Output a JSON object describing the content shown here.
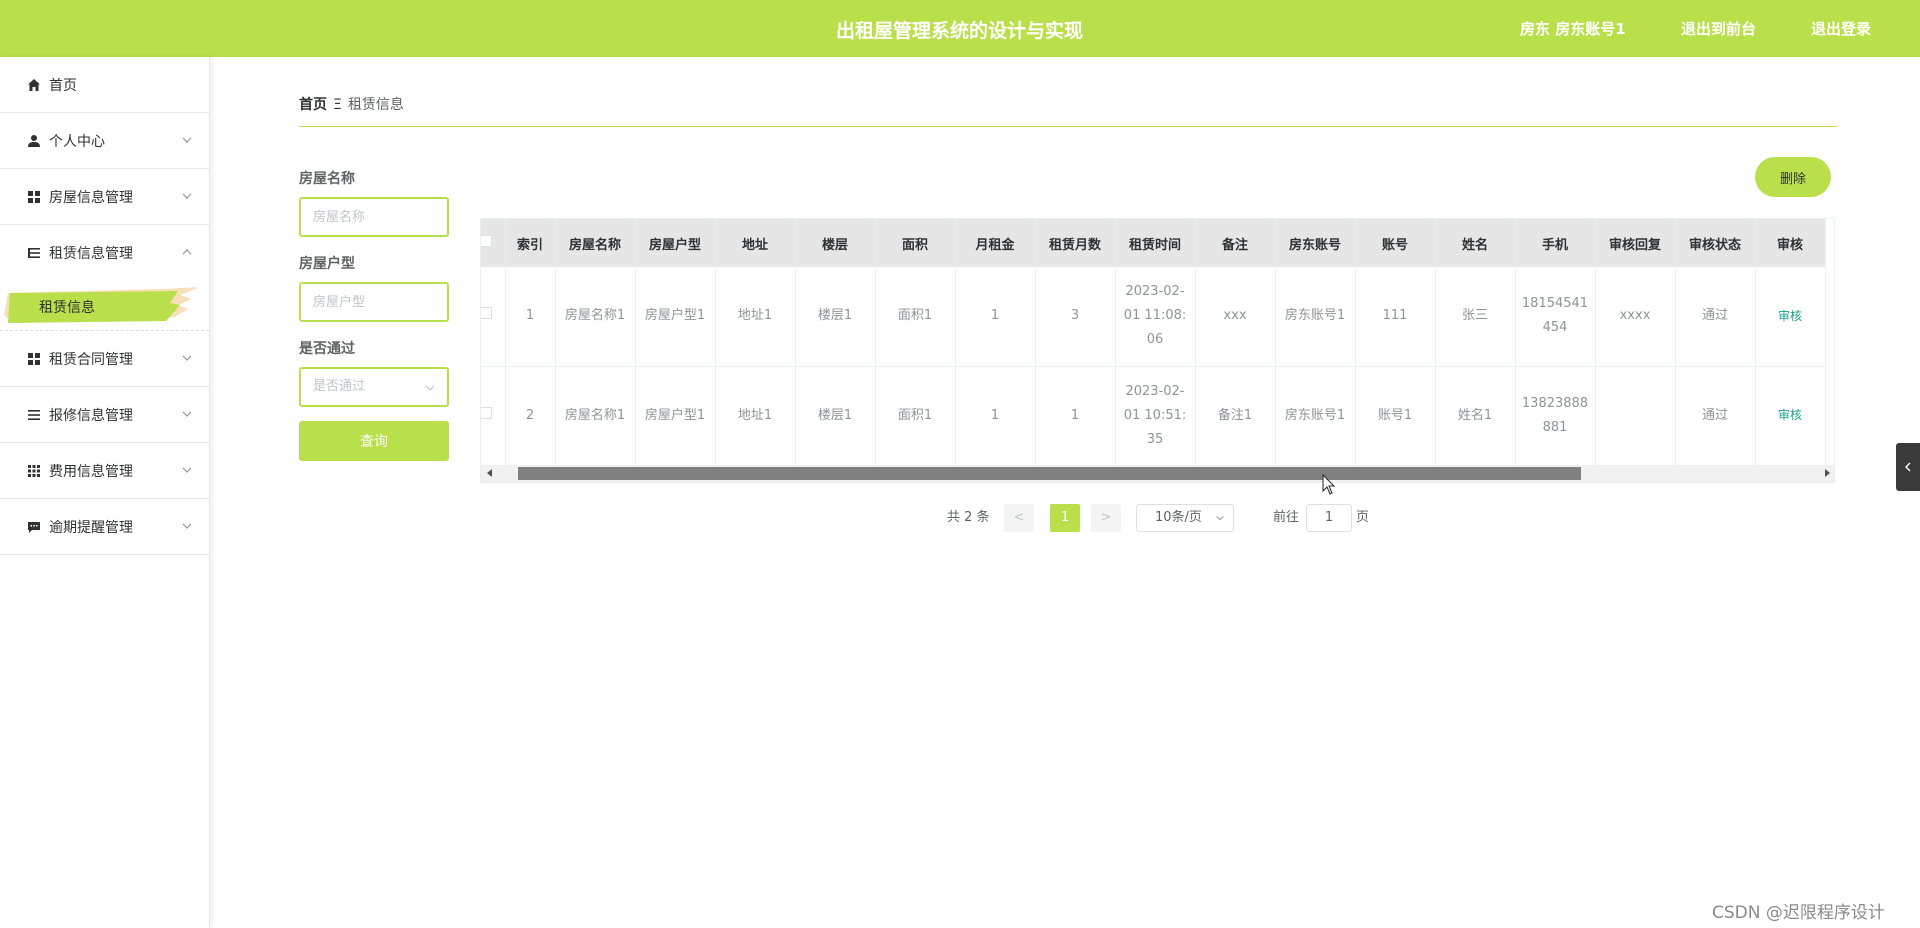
{
  "header": {
    "title": "出租屋管理系统的设计与实现",
    "user": "房东 房东账号1",
    "front_link": "退出到前台",
    "logout_link": "退出登录",
    "color": "#b9df4b"
  },
  "sidebar": {
    "items": [
      {
        "label": "首页",
        "icon": "home-icon"
      },
      {
        "label": "个人中心",
        "icon": "user-icon"
      },
      {
        "label": "房屋信息管理",
        "icon": "grid-icon"
      },
      {
        "label": "租赁信息管理",
        "icon": "list-icon"
      },
      {
        "label": "租赁合同管理",
        "icon": "grid-icon"
      },
      {
        "label": "报修信息管理",
        "icon": "list-icon"
      },
      {
        "label": "费用信息管理",
        "icon": "apps-icon"
      },
      {
        "label": "逾期提醒管理",
        "icon": "chat-icon"
      }
    ],
    "active_sub": "租赁信息"
  },
  "breadcrumb": {
    "home": "首页",
    "sep": "Ξ",
    "current": "租赁信息"
  },
  "search": {
    "name_label": "房屋名称",
    "name_placeholder": "房屋名称",
    "type_label": "房屋户型",
    "type_placeholder": "房屋户型",
    "pass_label": "是否通过",
    "pass_placeholder": "是否通过",
    "query_button": "查询"
  },
  "toolbar": {
    "delete_button": "删除"
  },
  "table": {
    "columns": [
      "索引",
      "房屋名称",
      "房屋户型",
      "地址",
      "楼层",
      "面积",
      "月租金",
      "租赁月数",
      "租赁时间",
      "备注",
      "房东账号",
      "账号",
      "姓名",
      "手机",
      "审核回复",
      "审核状态",
      "审核"
    ],
    "rows": [
      [
        "1",
        "房屋名称1",
        "房屋户型1",
        "地址1",
        "楼层1",
        "面积1",
        "1",
        "3",
        "2023-02-01 11:08:06",
        "xxx",
        "房东账号1",
        "111",
        "张三",
        "18154541454",
        "xxxx",
        "通过",
        "审核"
      ],
      [
        "2",
        "房屋名称1",
        "房屋户型1",
        "地址1",
        "楼层1",
        "面积1",
        "1",
        "1",
        "2023-02-01 10:51:35",
        "备注1",
        "房东账号1",
        "账号1",
        "姓名1",
        "13823888881",
        "",
        "通过",
        "审核"
      ]
    ]
  },
  "pagination": {
    "total": "共 2 条",
    "prev": "<",
    "page": "1",
    "next": ">",
    "page_size": "10条/页",
    "goto_label": "前往",
    "goto_value": "1",
    "page_unit": "页"
  },
  "watermark": "CSDN @迟限程序设计"
}
